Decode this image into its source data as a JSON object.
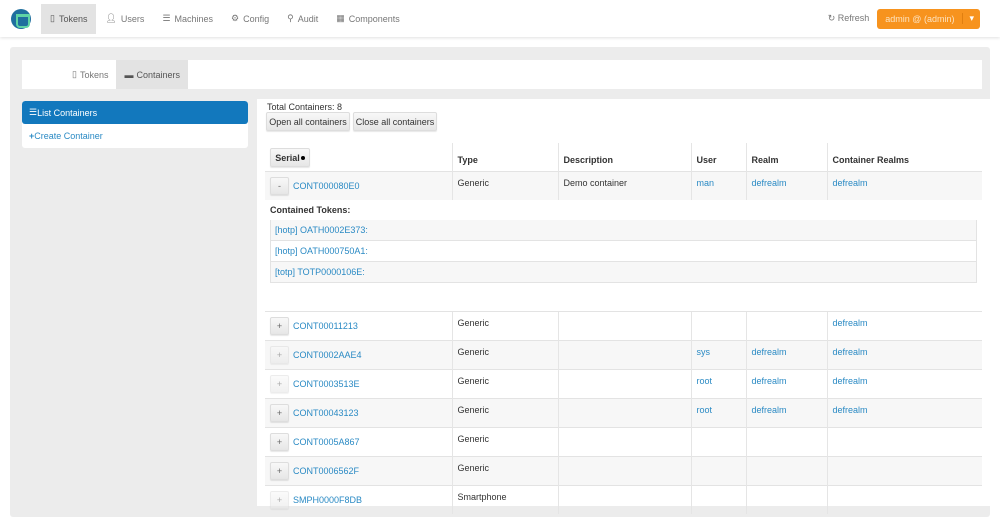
{
  "nav": {
    "items": [
      {
        "icon": "phone-icon",
        "label": "Tokens",
        "active": true
      },
      {
        "icon": "user-icon",
        "label": "Users"
      },
      {
        "icon": "list-icon",
        "label": "Machines"
      },
      {
        "icon": "gear-icon",
        "label": "Config"
      },
      {
        "icon": "search-icon",
        "label": "Audit"
      },
      {
        "icon": "calendar-icon",
        "label": "Components"
      }
    ],
    "refresh": "Refresh",
    "user": "admin @ (admin)"
  },
  "subnav": {
    "tokens": "Tokens",
    "containers": "Containers"
  },
  "sidebar": {
    "list": "List Containers",
    "create": "Create Container"
  },
  "main": {
    "total": "Total Containers: 8",
    "open_all": "Open all containers",
    "close_all": "Close all containers",
    "headers": {
      "serial": "Serial",
      "type": "Type",
      "description": "Description",
      "user": "User",
      "realm": "Realm",
      "container_realms": "Container Realms"
    },
    "contained_tokens_label": "Contained Tokens:",
    "rows": [
      {
        "toggle": "-",
        "serial": "CONT000080E0",
        "type": "Generic",
        "description": "Demo container",
        "user": "man",
        "realm": "defrealm",
        "container_realms": "defrealm",
        "tokens": [
          "[hotp] OATH0002E373:",
          "[hotp] OATH000750A1:",
          "[totp] TOTP0000106E:"
        ]
      },
      {
        "toggle": "+",
        "serial": "CONT00011213",
        "type": "Generic",
        "description": "",
        "user": "",
        "realm": "",
        "container_realms": "defrealm"
      },
      {
        "toggle": "+",
        "serial": "CONT0002AAE4",
        "type": "Generic",
        "description": "",
        "user": "sys",
        "realm": "defrealm",
        "container_realms": "defrealm"
      },
      {
        "toggle": "+",
        "serial": "CONT0003513E",
        "type": "Generic",
        "description": "",
        "user": "root",
        "realm": "defrealm",
        "container_realms": "defrealm"
      },
      {
        "toggle": "+",
        "serial": "CONT00043123",
        "type": "Generic",
        "description": "",
        "user": "root",
        "realm": "defrealm",
        "container_realms": "defrealm"
      },
      {
        "toggle": "+",
        "serial": "CONT0005A867",
        "type": "Generic",
        "description": "",
        "user": "",
        "realm": "",
        "container_realms": ""
      },
      {
        "toggle": "+",
        "serial": "CONT0006562F",
        "type": "Generic",
        "description": "",
        "user": "",
        "realm": "",
        "container_realms": ""
      },
      {
        "toggle": "+",
        "serial": "SMPH0000F8DB",
        "type": "Smartphone",
        "description": "",
        "user": "",
        "realm": "",
        "container_realms": ""
      }
    ]
  }
}
